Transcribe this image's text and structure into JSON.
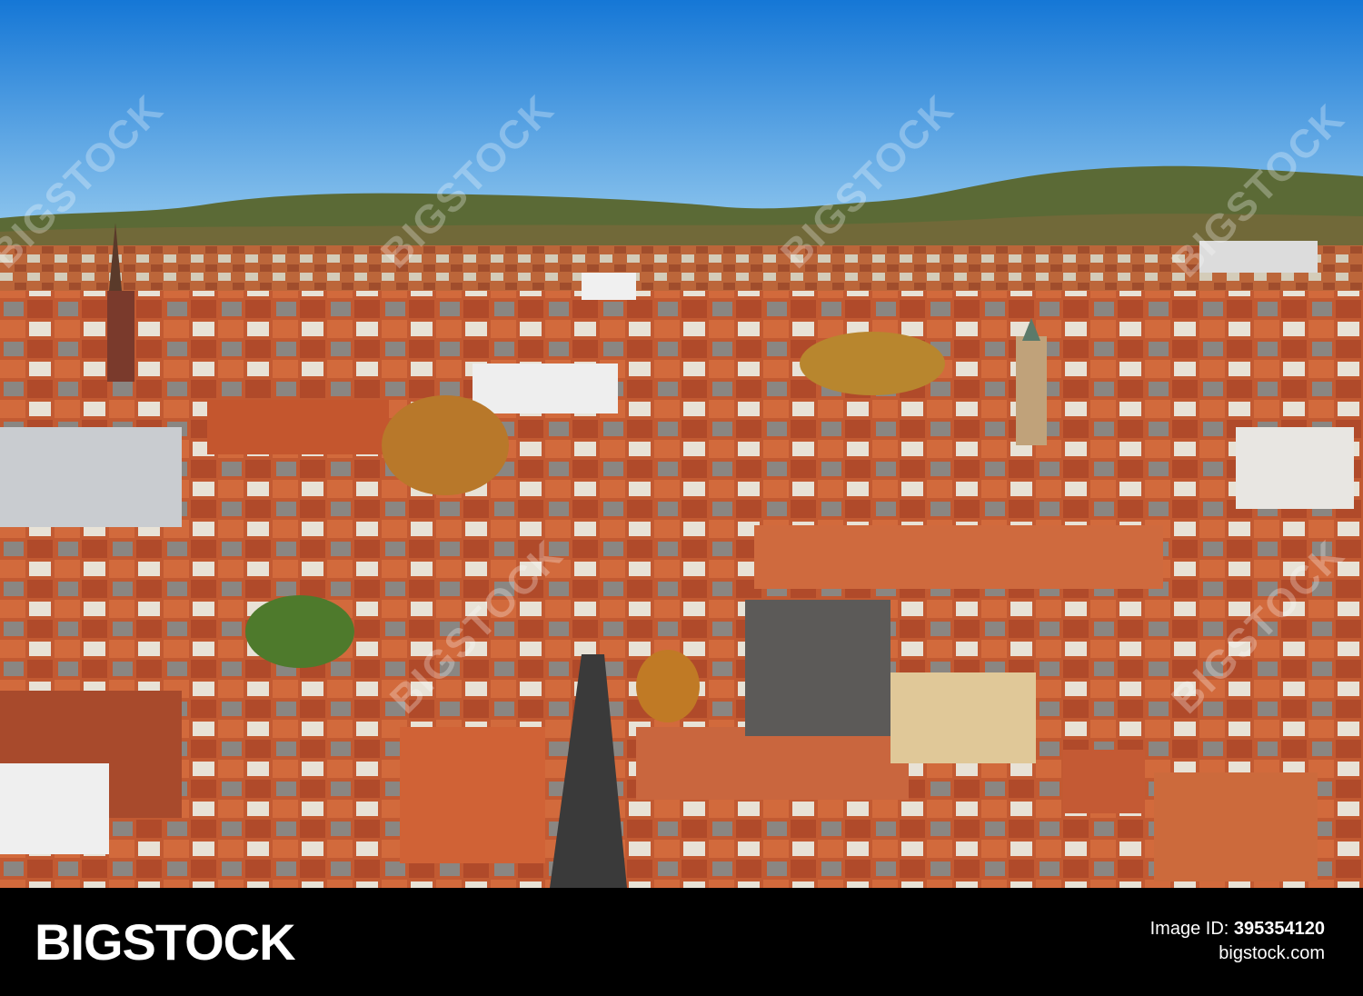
{
  "watermark": {
    "text": "BIGSTOCK"
  },
  "footer": {
    "brand": "BIGSTOCK",
    "image_id_label": "Image ID:",
    "image_id": "395354120",
    "site": "bigstock.com"
  },
  "colors": {
    "sky_top": "#1a7fd9",
    "sky_bottom": "#8ec6ee",
    "hills": "#5a6a35",
    "roofs": "#c4562e",
    "walls": "#e9e3d8",
    "footer_bg": "#000000"
  }
}
